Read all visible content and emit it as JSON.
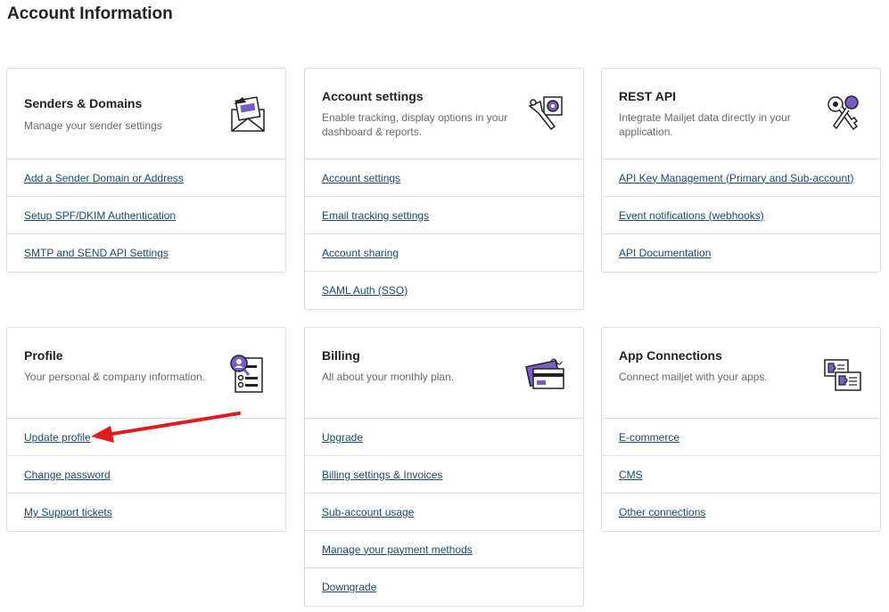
{
  "page": {
    "title": "Account Information"
  },
  "cards": {
    "senders": {
      "title": "Senders & Domains",
      "desc": "Manage your sender settings",
      "icon": "envelope-icon",
      "links": [
        "Add a Sender Domain or Address",
        "Setup SPF/DKIM Authentication",
        "SMTP and SEND API Settings"
      ]
    },
    "account": {
      "title": "Account settings",
      "desc": "Enable tracking, display options in your dashboard & reports.",
      "icon": "wrench-gear-icon",
      "links": [
        "Account settings",
        "Email tracking settings",
        "Account sharing",
        "SAML Auth (SSO)"
      ]
    },
    "rest": {
      "title": "REST API",
      "desc": "Integrate Mailjet data directly in your application.",
      "icon": "keys-icon",
      "links": [
        "API Key Management (Primary and Sub-account)",
        "Event notifications (webhooks)",
        "API Documentation"
      ]
    },
    "profile": {
      "title": "Profile",
      "desc": "Your personal & company information.",
      "icon": "profile-card-icon",
      "links": [
        "Update profile",
        "Change password",
        "My Support tickets"
      ]
    },
    "billing": {
      "title": "Billing",
      "desc": "All about your monthly plan.",
      "icon": "credit-card-icon",
      "links": [
        "Upgrade",
        "Billing settings & Invoices",
        "Sub-account usage",
        "Manage your payment methods",
        "Downgrade"
      ]
    },
    "apps": {
      "title": "App Connections",
      "desc": "Connect mailjet with your apps.",
      "icon": "app-connections-icon",
      "links": [
        "E-commerce",
        "CMS",
        "Other connections"
      ]
    }
  },
  "annotation": {
    "arrow_color": "#e01b1b"
  },
  "colors": {
    "accent": "#7b5cc4",
    "link": "#1b4b6b"
  }
}
